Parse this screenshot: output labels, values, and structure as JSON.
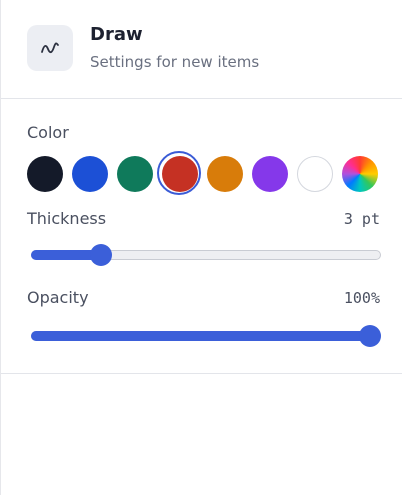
{
  "header": {
    "title": "Draw",
    "subtitle": "Settings for new items",
    "icon": "draw-squiggle-icon"
  },
  "color": {
    "label": "Color",
    "selected_index": 3,
    "swatches": [
      {
        "name": "black",
        "hex": "#141a29"
      },
      {
        "name": "blue",
        "hex": "#1c50d6"
      },
      {
        "name": "green",
        "hex": "#0f7a5b"
      },
      {
        "name": "red",
        "hex": "#c53123"
      },
      {
        "name": "orange",
        "hex": "#d87c0a"
      },
      {
        "name": "purple",
        "hex": "#8538ea"
      },
      {
        "name": "white",
        "hex": "#ffffff"
      },
      {
        "name": "custom",
        "hex": "conic-rainbow"
      }
    ]
  },
  "thickness": {
    "label": "Thickness",
    "value_text": "3 pt",
    "fraction": 0.18
  },
  "opacity": {
    "label": "Opacity",
    "value_text": "100%",
    "fraction": 1.0
  },
  "accent": "#3b5fd9"
}
